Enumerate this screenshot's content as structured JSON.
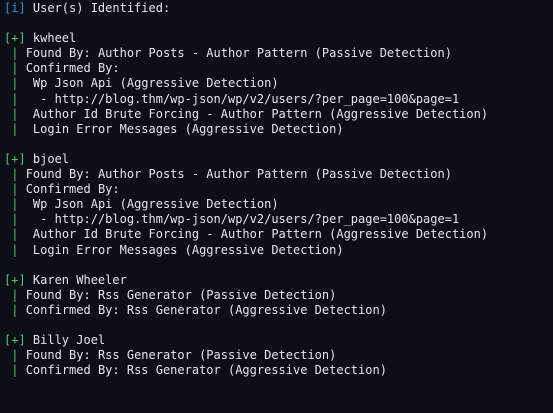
{
  "header": {
    "tag": "[i]",
    "text": " User(s) Identified:"
  },
  "users": [
    {
      "tag": "[+]",
      "name": " kwheel",
      "lines": [
        " | Found By: Author Posts - Author Pattern (Passive Detection)",
        " | Confirmed By:",
        " |  Wp Json Api (Aggressive Detection)",
        " |   - http://blog.thm/wp-json/wp/v2/users/?per_page=100&page=1",
        " |  Author Id Brute Forcing - Author Pattern (Aggressive Detection)",
        " |  Login Error Messages (Aggressive Detection)"
      ]
    },
    {
      "tag": "[+]",
      "name": " bjoel",
      "lines": [
        " | Found By: Author Posts - Author Pattern (Passive Detection)",
        " | Confirmed By:",
        " |  Wp Json Api (Aggressive Detection)",
        " |   - http://blog.thm/wp-json/wp/v2/users/?per_page=100&page=1",
        " |  Author Id Brute Forcing - Author Pattern (Aggressive Detection)",
        " |  Login Error Messages (Aggressive Detection)"
      ]
    },
    {
      "tag": "[+]",
      "name": " Karen Wheeler",
      "lines": [
        " | Found By: Rss Generator (Passive Detection)",
        " | Confirmed By: Rss Generator (Aggressive Detection)"
      ]
    },
    {
      "tag": "[+]",
      "name": " Billy Joel",
      "lines": [
        " | Found By: Rss Generator (Passive Detection)",
        " | Confirmed By: Rss Generator (Aggressive Detection)"
      ]
    }
  ],
  "colors": {
    "background": "#0d0f17",
    "text": "#e4e6ee",
    "info_tag": "#3d8fd6",
    "success_tag": "#4fc36e"
  }
}
